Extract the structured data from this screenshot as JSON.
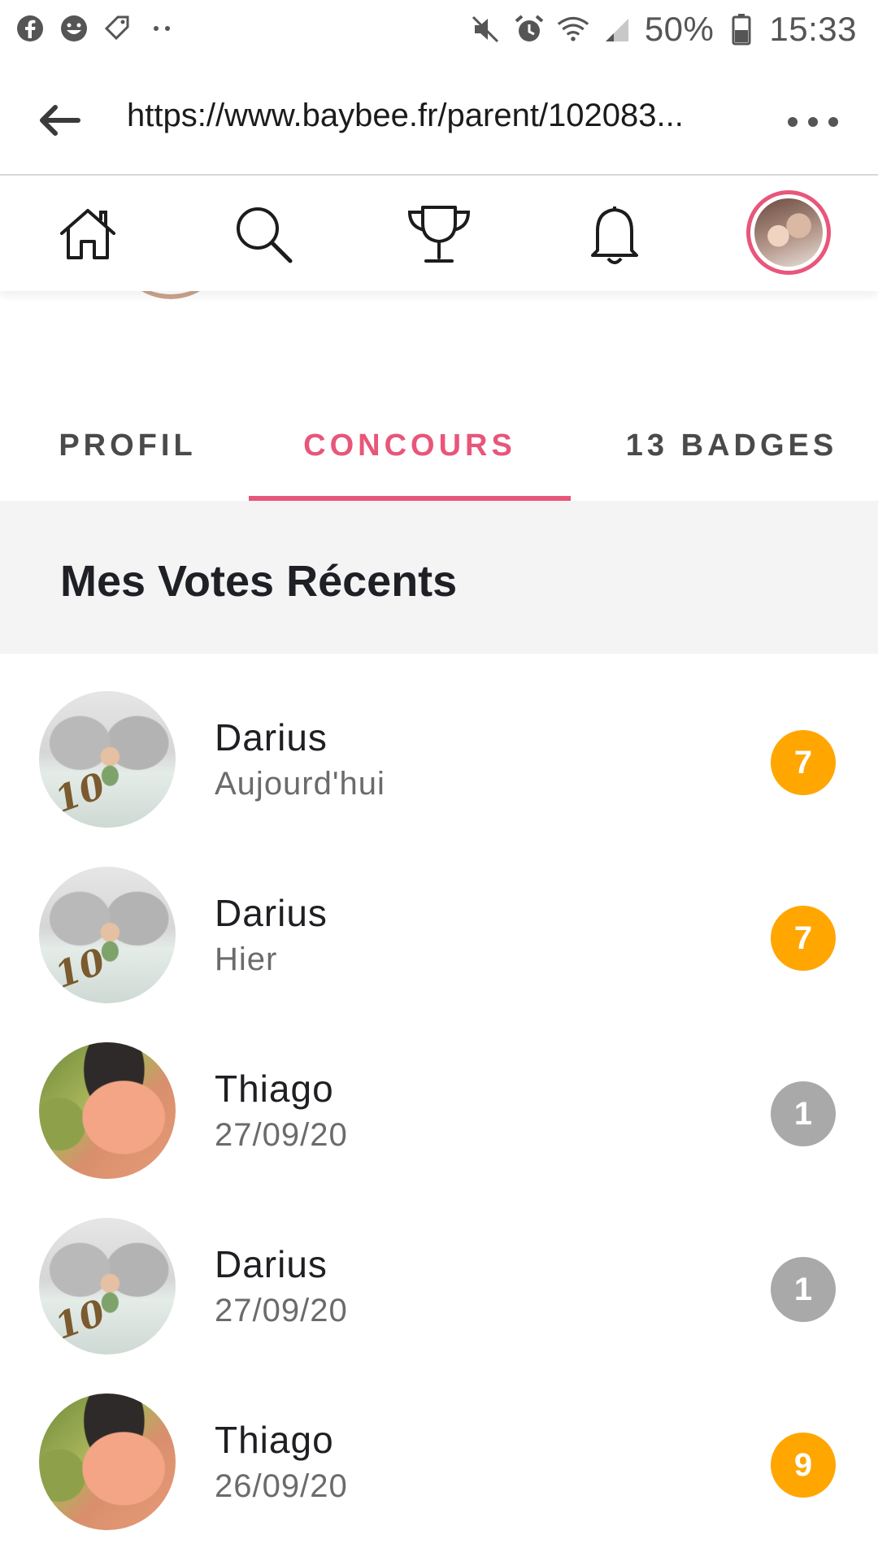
{
  "status_bar": {
    "left_icons": [
      "facebook-icon",
      "smiley-icon",
      "tag-icon",
      "more-dots-icon"
    ],
    "right_icons": [
      "mute-icon",
      "alarm-icon",
      "wifi-icon",
      "signal-icon",
      "battery-icon"
    ],
    "battery": "50%",
    "time": "15:33"
  },
  "browser": {
    "url": "https://www.baybee.fr/parent/102083..."
  },
  "nav": {
    "items": [
      "home-icon",
      "search-icon",
      "trophy-icon",
      "bell-icon",
      "profile-avatar"
    ]
  },
  "tabs": [
    {
      "label": "PROFIL",
      "active": false
    },
    {
      "label": "CONCOURS",
      "active": true
    },
    {
      "label": "13 BADGES",
      "active": false
    }
  ],
  "section": {
    "title": "Mes Votes Récents"
  },
  "votes": [
    {
      "name": "Darius",
      "date": "Aujourd'hui",
      "score": "7",
      "badge_color": "#ffa600",
      "avatar": "darius"
    },
    {
      "name": "Darius",
      "date": "Hier",
      "score": "7",
      "badge_color": "#ffa600",
      "avatar": "darius"
    },
    {
      "name": "Thiago",
      "date": "27/09/20",
      "score": "1",
      "badge_color": "#a9a9a9",
      "avatar": "thiago"
    },
    {
      "name": "Darius",
      "date": "27/09/20",
      "score": "1",
      "badge_color": "#a9a9a9",
      "avatar": "darius"
    },
    {
      "name": "Thiago",
      "date": "26/09/20",
      "score": "9",
      "badge_color": "#ffa600",
      "avatar": "thiago"
    }
  ],
  "colors": {
    "accent": "#e8567a",
    "badge_high": "#ffa600",
    "badge_low": "#a9a9a9",
    "section_bg": "#f4f4f5"
  }
}
